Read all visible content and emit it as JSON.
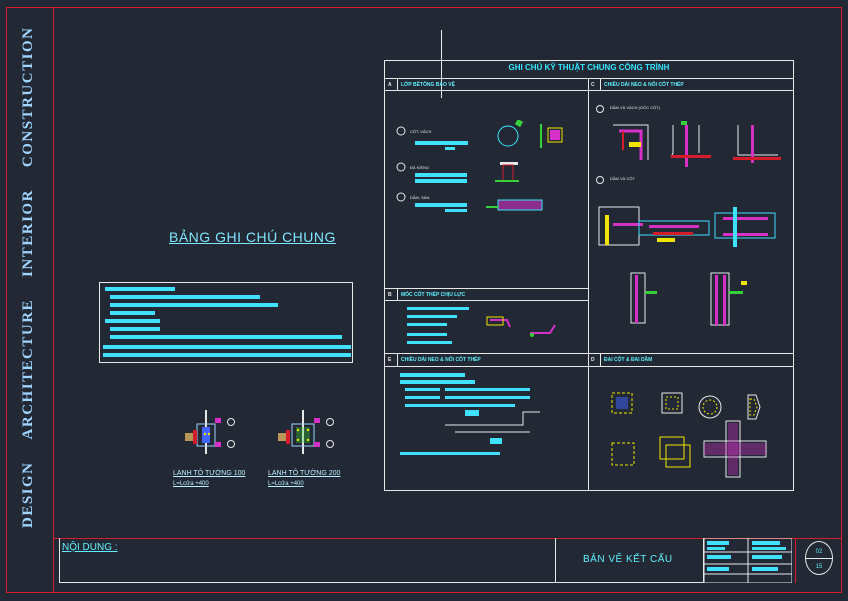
{
  "sidebar": {
    "words": [
      "DESIGN",
      "ARCHITECTURE",
      "INTERIOR",
      "CONSTRUCTION"
    ]
  },
  "main_title": "BẢNG GHI CHÚ CHUNG",
  "spec": {
    "title": "GHI CHÚ KỸ THUẬT CHUNG CÔNG TRÌNH",
    "sections": {
      "A": {
        "letter": "A",
        "title": "LỚP BÊTÔNG BẢO VỆ"
      },
      "B": {
        "letter": "B",
        "title": "MÓC CỐT THÉP CHỊU LỰC"
      },
      "C": {
        "letter": "C",
        "title": "CHIỀU DÀI NEO & NỐI CỐT THÉP"
      },
      "E": {
        "letter": "E",
        "title": "CHIỀU DÀI NEO & NỐI CỐT THÉP"
      },
      "D": {
        "letter": "D",
        "title": "ĐAI CỘT & ĐAI DẦM"
      }
    },
    "a_items": [
      "CỘT, VÁCH",
      "ĐÀ KIỀNG",
      "DẦM, SÀN"
    ],
    "c_items": [
      "DẦM VÀ VÁCH (GÓC CỘT)",
      "DẦM VÀ CỘT"
    ]
  },
  "details": [
    {
      "caption": "LANH TÔ TƯỜNG 100",
      "sub": "L=Lcửa +400"
    },
    {
      "caption": "LANH TÔ TƯỜNG 200",
      "sub": "L=Lcửa +400"
    }
  ],
  "title_block": {
    "content_label": "NỘI DUNG :",
    "drawing_name": "BẢN VẼ KẾT CẤU",
    "sheet_top": "02",
    "sheet_bottom": "15"
  },
  "colors": {
    "background": "#222834",
    "frame": "#d41c2b",
    "cyan": "#3fe1ff",
    "green": "#36d13a",
    "yellow": "#f2e600",
    "magenta": "#d630c8"
  }
}
